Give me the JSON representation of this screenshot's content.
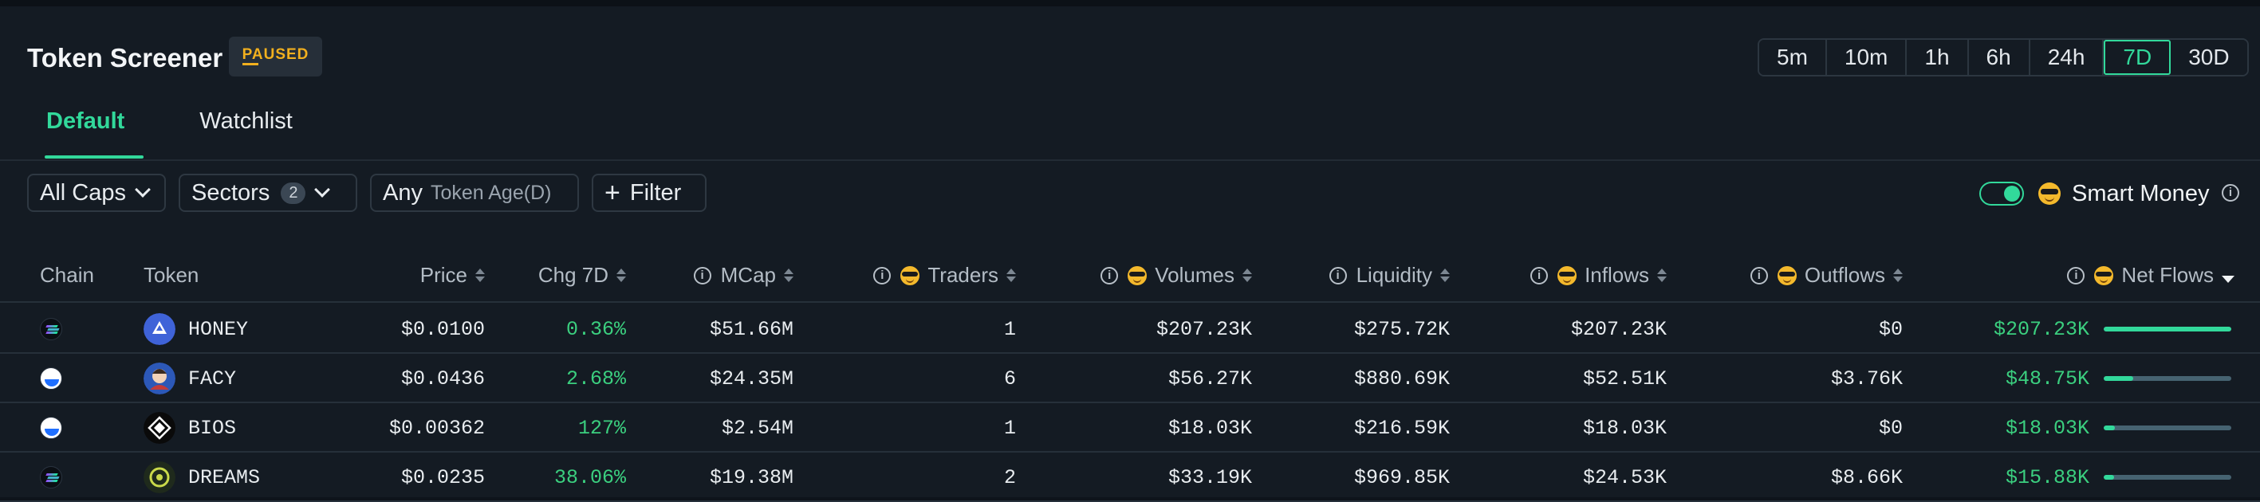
{
  "header": {
    "title": "Token Screener",
    "status_badge": "PAUSED",
    "timeframes": [
      "5m",
      "10m",
      "1h",
      "6h",
      "24h",
      "7D",
      "30D"
    ],
    "active_timeframe": "7D"
  },
  "tabs": [
    {
      "label": "Default",
      "active": true
    },
    {
      "label": "Watchlist",
      "active": false
    }
  ],
  "filters": {
    "caps": "All Caps",
    "sectors_label": "Sectors",
    "sectors_count": "2",
    "age_value": "Any",
    "age_label": "Token Age(D)",
    "filter_label": "Filter",
    "smart_money_label": "Smart Money",
    "smart_money_enabled": true
  },
  "columns": {
    "chain": "Chain",
    "token": "Token",
    "price": "Price",
    "chg": "Chg 7D",
    "mcap": "MCap",
    "traders": "Traders",
    "volumes": "Volumes",
    "liquidity": "Liquidity",
    "inflows": "Inflows",
    "outflows": "Outflows",
    "netflows": "Net Flows"
  },
  "rows": [
    {
      "chain": "solana",
      "token": "HONEY",
      "price": "$0.0100",
      "chg": "0.36%",
      "mcap": "$51.66M",
      "traders": "1",
      "volumes": "$207.23K",
      "liquidity": "$275.72K",
      "inflows": "$207.23K",
      "outflows": "$0",
      "netflows": "$207.23K",
      "flow_share": 1.0
    },
    {
      "chain": "base",
      "token": "FACY",
      "price": "$0.0436",
      "chg": "2.68%",
      "mcap": "$24.35M",
      "traders": "6",
      "volumes": "$56.27K",
      "liquidity": "$880.69K",
      "inflows": "$52.51K",
      "outflows": "$3.76K",
      "netflows": "$48.75K",
      "flow_share": 0.23
    },
    {
      "chain": "base",
      "token": "BIOS",
      "price": "$0.00362",
      "chg": "127%",
      "mcap": "$2.54M",
      "traders": "1",
      "volumes": "$18.03K",
      "liquidity": "$216.59K",
      "inflows": "$18.03K",
      "outflows": "$0",
      "netflows": "$18.03K",
      "flow_share": 0.09
    },
    {
      "chain": "solana",
      "token": "DREAMS",
      "price": "$0.0235",
      "chg": "38.06%",
      "mcap": "$19.38M",
      "traders": "2",
      "volumes": "$33.19K",
      "liquidity": "$969.85K",
      "inflows": "$24.53K",
      "outflows": "$8.66K",
      "netflows": "$15.88K",
      "flow_share": 0.08
    }
  ],
  "colors": {
    "accent": "#32d99b",
    "positive": "#3bcf7f",
    "paused": "#f2b01e"
  }
}
